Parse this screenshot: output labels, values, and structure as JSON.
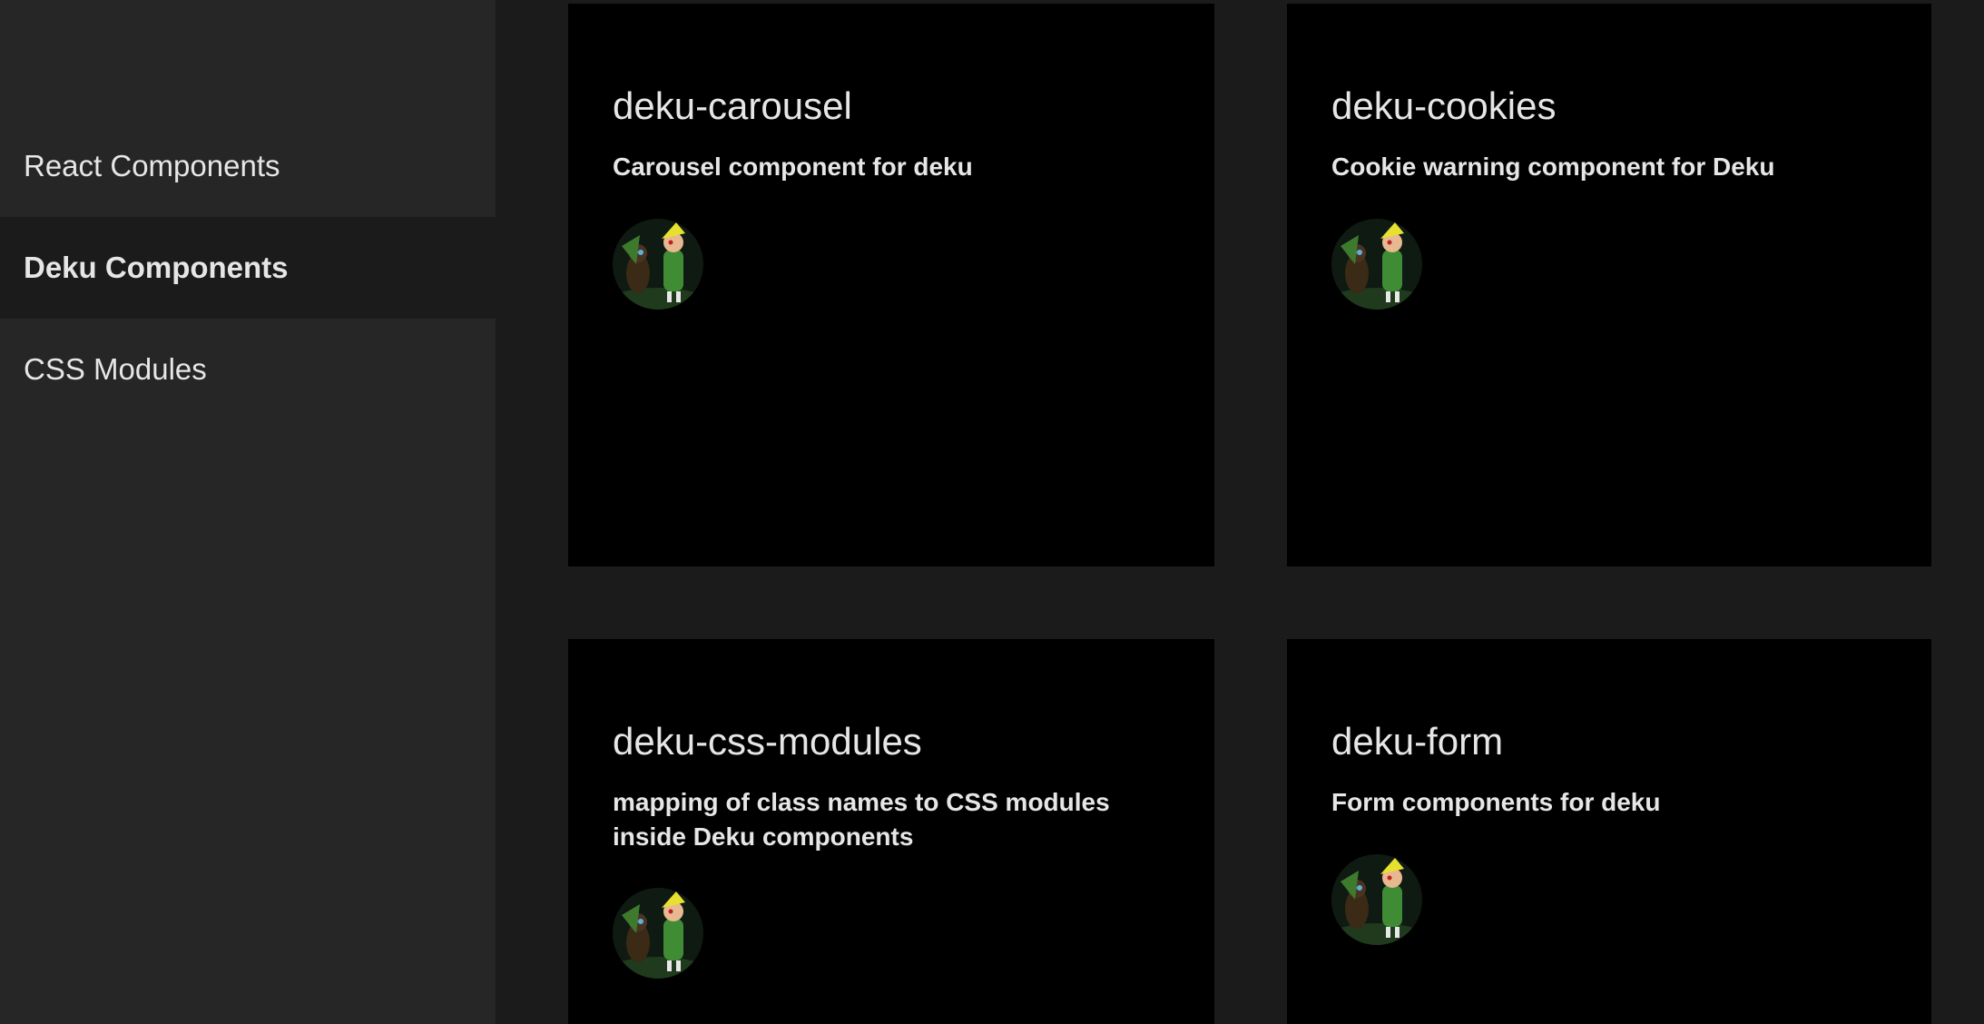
{
  "sidebar": {
    "items": [
      {
        "label": "React Components",
        "active": false
      },
      {
        "label": "Deku Components",
        "active": true
      },
      {
        "label": "CSS Modules",
        "active": false
      }
    ]
  },
  "cards": [
    {
      "title": "deku-carousel",
      "description": "Carousel component for deku",
      "avatar_icon": "avatar-icon"
    },
    {
      "title": "deku-cookies",
      "description": "Cookie warning component for Deku",
      "avatar_icon": "avatar-icon"
    },
    {
      "title": "deku-css-modules",
      "description": "mapping of class names to CSS modules inside Deku components",
      "avatar_icon": "avatar-icon"
    },
    {
      "title": "deku-form",
      "description": "Form components for deku",
      "avatar_icon": "avatar-icon"
    }
  ],
  "colors": {
    "page_bg": "#1b1b1b",
    "sidebar_bg": "#262626",
    "card_bg": "#000000",
    "text": "#e6e6e6"
  }
}
